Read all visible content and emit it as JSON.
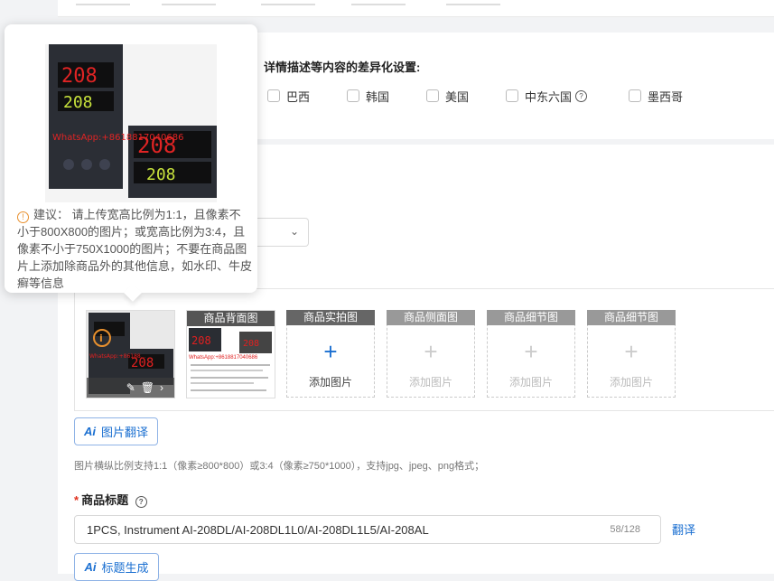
{
  "differentiation": {
    "title": "详情描述等内容的差异化设置:",
    "countries": [
      {
        "label": "巴西"
      },
      {
        "label": "韩国"
      },
      {
        "label": "美国"
      },
      {
        "label": "中东六国"
      },
      {
        "label": "墨西哥"
      }
    ]
  },
  "tooltip": {
    "suggestion": "建议： 请上传宽高比例为1:1，且像素不小于800X800的图片；或宽高比例为3:4，且像素不小于750X1000的图片；不要在商品图片上添加除商品外的其他信息，如水印、牛皮癣等信息",
    "image_watermark": "WhatsApp:+8618817040686",
    "image_display_1": "208",
    "image_display_2": "208"
  },
  "images": {
    "slots": [
      {
        "caption": "商品背面图",
        "watermark": "WhatsApp:+8618817040686"
      },
      {
        "caption": "商品实拍图",
        "add_label": "添加图片"
      },
      {
        "caption": "商品侧面图",
        "add_label": "添加图片"
      },
      {
        "caption": "商品细节图",
        "add_label": "添加图片"
      },
      {
        "caption": "商品细节图",
        "add_label": "添加图片"
      }
    ],
    "translate_button": "图片翻译",
    "hint": "图片横纵比例支持1:1（像素≥800*800）或3:4（像素≥750*1000），支持jpg、jpeg、png格式；"
  },
  "title_field": {
    "required_mark": "*",
    "label": "商品标题",
    "value": "1PCS, Instrument AI-208DL/AI-208DL1L0/AI-208DL1L5/AI-208AL",
    "counter": "58/128",
    "translate_link": "翻译",
    "generate_button": "标题生成"
  },
  "colors": {
    "accent": "#1a6fd1",
    "required": "#e0301e",
    "warning": "#e8902e"
  }
}
